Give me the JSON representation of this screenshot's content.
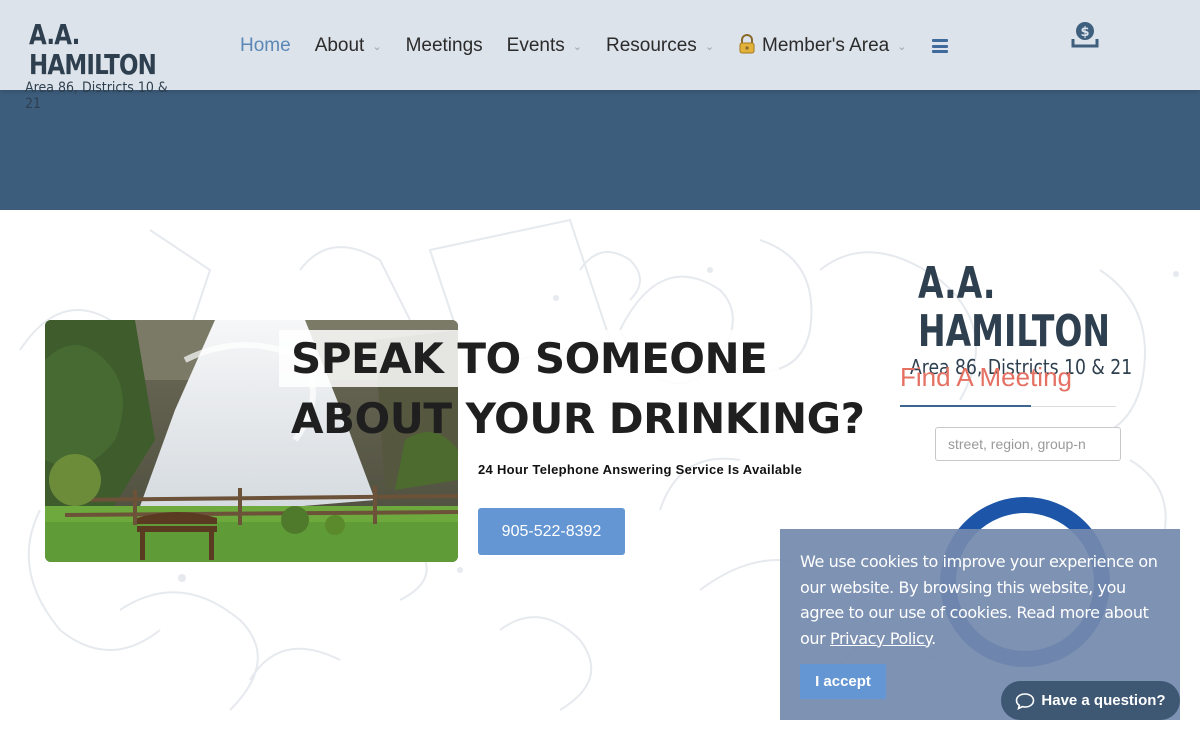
{
  "header": {
    "logo_title": "A.A. HAMILTON",
    "logo_subtitle": "Area 86, Districts 10 & 21",
    "nav": [
      {
        "label": "Home",
        "active": true
      },
      {
        "label": "About",
        "has_dropdown": true
      },
      {
        "label": "Meetings"
      },
      {
        "label": "Events",
        "has_dropdown": true
      },
      {
        "label": "Resources",
        "has_dropdown": true
      },
      {
        "label": "Member's Area",
        "has_dropdown": true,
        "icon": "lock-icon"
      }
    ],
    "menu_icon": "hamburger-icon",
    "donate_icon": "donate-icon"
  },
  "hero": {
    "headline_line1": "SPEAK TO SOMEONE",
    "headline_line2": "ABOUT YOUR DRINKING?",
    "subtext": "24 Hour Telephone Answering Service Is Available",
    "phone_button": "905-522-8392",
    "image": "waterfall-with-bench"
  },
  "sidebar": {
    "logo_title": "A.A. HAMILTON",
    "logo_subtitle": "Area 86, Districts 10 & 21",
    "find_title": "Find A Meeting",
    "search_placeholder": "street, region, group-n"
  },
  "cookie": {
    "text_before": "We use cookies to improve your experience on our website. By browsing this website, you agree to our use of cookies. Read more about our ",
    "link": "Privacy Policy",
    "text_after": ".",
    "accept_label": "I accept"
  },
  "chat": {
    "label": "Have a question?",
    "icon": "chat-bubble-icon"
  },
  "colors": {
    "header_bg": "#dde3ea",
    "banner_bg": "#3d5d7d",
    "accent_blue": "#6596d4",
    "find_title": "#e57163",
    "nav_active": "#5b87b6"
  }
}
